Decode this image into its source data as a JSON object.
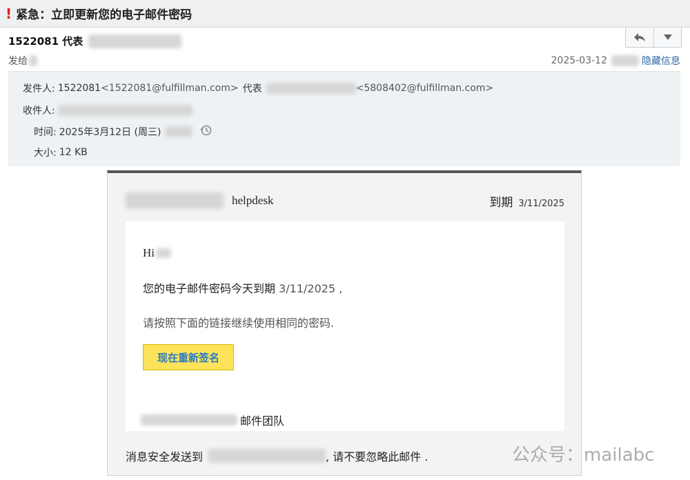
{
  "subject": {
    "urgent_mark": "!",
    "title": "紧急：立即更新您的电子邮件密码"
  },
  "header": {
    "sender_short": "1522081 代表",
    "to_label": "发给",
    "date": "2025-03-12",
    "hide_details": "隐藏信息"
  },
  "toolbar": {
    "reply_icon": "reply-icon",
    "more_icon": "dropdown-arrow-icon"
  },
  "details": {
    "from_label": "发件人:",
    "from_name": "1522081",
    "from_addr": "<1522081@fulfillman.com>",
    "on_behalf": "代表",
    "behalf_addr": "<5808402@fulfillman.com>",
    "to_label": "收件人:",
    "time_label": "时间:",
    "time_value": "2025年3月12日 (周三)",
    "size_label": "大小:",
    "size_value": "12 KB"
  },
  "body": {
    "brand": "helpdesk",
    "expires_label": "到期",
    "expires_date": "3/11/2025",
    "greeting": "Hi",
    "line1": "您的电子邮件密码今天到期",
    "line1_date": "3/11/2025 ,",
    "line2": "请按照下面的链接继续使用相同的密码.",
    "button": "现在重新签名",
    "team": "邮件团队",
    "footer_prefix": "消息安全发送到",
    "footer_suffix": ", 请不要忽略此邮件 ."
  },
  "watermark": "公众号：mailabc",
  "colors": {
    "urgent": "#e02020",
    "link": "#2d6aa8",
    "button_bg": "#fce35a",
    "button_text": "#2a7bc0"
  }
}
